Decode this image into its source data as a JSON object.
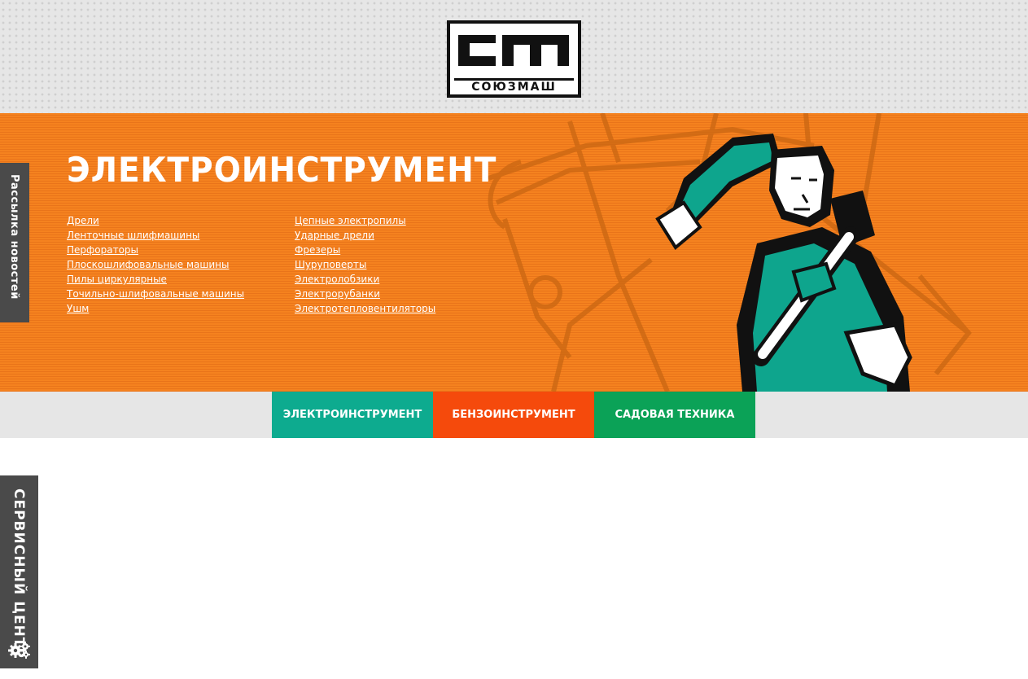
{
  "colors": {
    "hero_orange": "#f5821f",
    "tab_electro": "#0dab8f",
    "tab_benzo": "#f54a0c",
    "tab_garden": "#0ba257",
    "side_tab": "#4a4a4a"
  },
  "header": {
    "logo_text": "СОЮЗМАШ",
    "logo_icon": "cm-logo-icon"
  },
  "hero": {
    "title": "ЭЛЕКТРОИНСТРУМЕНТ",
    "links_col1": [
      "Дрели",
      "Ленточные шлифмашины",
      "Перфораторы",
      "Плоскошлифовальные машины",
      "Пилы циркулярные",
      "Точильно-шлифовальные машины",
      "Ушм"
    ],
    "links_col2": [
      "Цепные электропилы",
      "Ударные дрели",
      "Фрезеры",
      "Шуруповерты",
      "Электролобзики",
      "Электрорубанки",
      "Электротепловентиляторы"
    ]
  },
  "side": {
    "news": "Рассылка новостей",
    "service": "СЕРВИСНЫЙ ЦЕНТР",
    "service_icon": "gears-icon"
  },
  "tabs": [
    {
      "label": "ЭЛЕКТРОИНСТРУМЕНТ"
    },
    {
      "label": "БЕНЗОИНСТРУМЕНТ"
    },
    {
      "label": "САДОВАЯ ТЕХНИКА"
    }
  ]
}
